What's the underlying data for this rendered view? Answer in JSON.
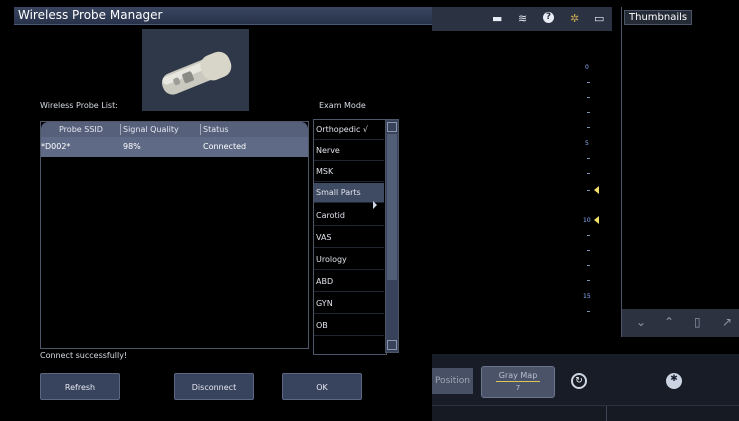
{
  "dialog": {
    "title": "Wireless Probe Manager",
    "probe_list_label": "Wireless Probe List:",
    "exam_mode_label": "Exam Mode",
    "columns": [
      "Probe SSID",
      "Signal Quality",
      "Status"
    ],
    "probes": [
      {
        "ssid": "*D002*",
        "signal": "98%",
        "status": "Connected"
      }
    ],
    "exam_modes": [
      {
        "label": "Orthopedic √",
        "selected": false
      },
      {
        "label": "Nerve",
        "selected": false
      },
      {
        "label": "MSK",
        "selected": false
      },
      {
        "label": "Small Parts",
        "selected": true
      },
      {
        "label": "Carotid",
        "selected": false
      },
      {
        "label": "VAS",
        "selected": false
      },
      {
        "label": "Urology",
        "selected": false
      },
      {
        "label": "ABD",
        "selected": false
      },
      {
        "label": "GYN",
        "selected": false
      },
      {
        "label": "OB",
        "selected": false
      }
    ],
    "status_message": "Connect successfully!",
    "buttons": {
      "refresh": "Refresh",
      "disconnect": "Disconnect",
      "ok": "OK"
    }
  },
  "background": {
    "thumbnails_title": "Thumbnails",
    "position_fragment": "Position",
    "gray_map_label": "Gray Map",
    "gray_map_value": "7",
    "depth_labels": [
      "0",
      "5",
      "10",
      "15"
    ],
    "status_icons": [
      "battery-icon",
      "wifi-icon",
      "help-icon",
      "settings-icon",
      "monitor-icon"
    ]
  }
}
